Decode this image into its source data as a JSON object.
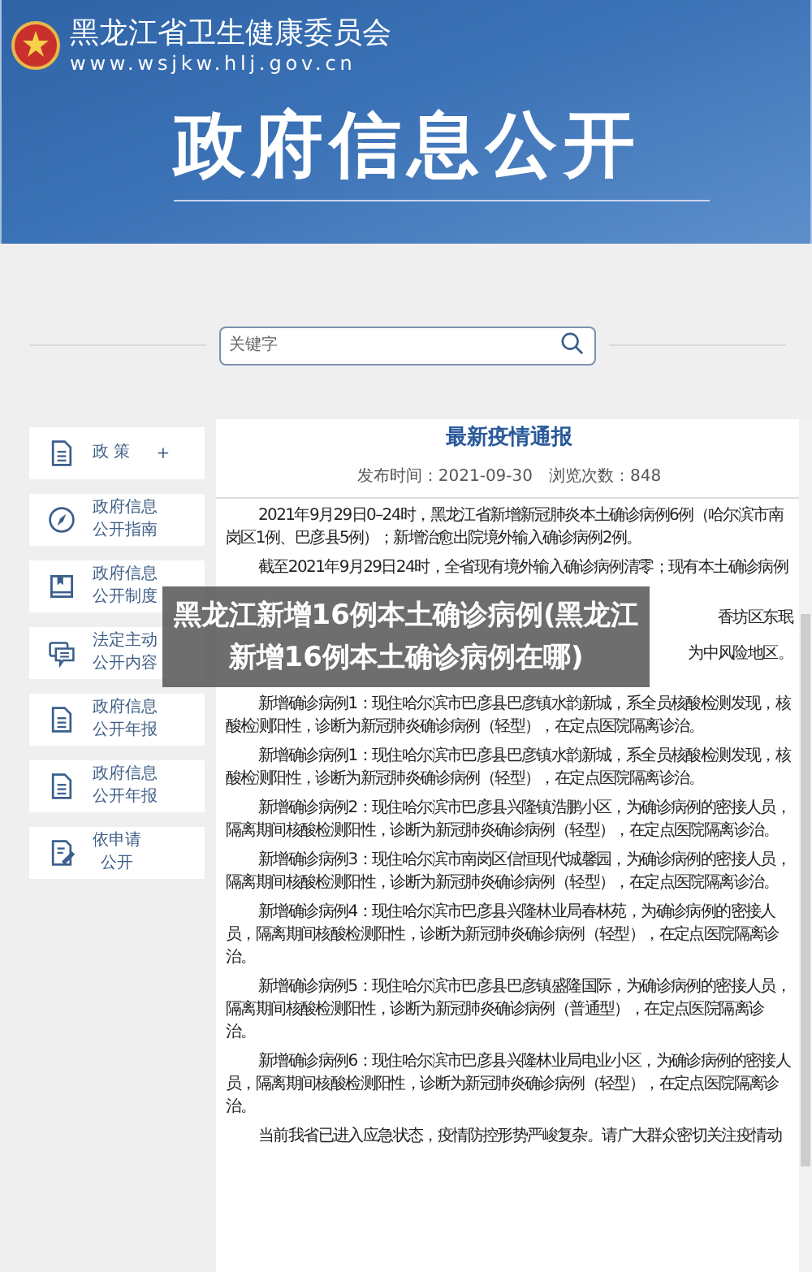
{
  "header": {
    "org_name": "黑龙江省卫生健康委员会",
    "url": "www.wsjkw.hlj.gov.cn",
    "title": "政府信息公开"
  },
  "search": {
    "placeholder": "关键字"
  },
  "sidebar": {
    "items": [
      {
        "lines": [
          "政 策"
        ],
        "expander": "+"
      },
      {
        "lines": [
          "政府信息",
          "公开指南"
        ]
      },
      {
        "lines": [
          "政府信息",
          "公开制度"
        ]
      },
      {
        "lines": [
          "法定主动",
          "公开内容"
        ]
      },
      {
        "lines": [
          "政府信息",
          "公开年报"
        ]
      },
      {
        "lines": [
          "政府信息",
          "公开年报"
        ]
      },
      {
        "lines": [
          "依申请",
          "公开"
        ]
      }
    ]
  },
  "article": {
    "title": "最新疫情通报",
    "meta": "发布时间：2021-09-30　浏览次数：848",
    "paragraphs": [
      {
        "kind": "text",
        "text": "2021年9月29日0–24时，黑龙江省新增新冠肺炎本土确诊病例6例（哈尔滨市南岗区1例、巴彦县5例）；新增治愈出院境外输入确诊病例2例。"
      },
      {
        "kind": "text",
        "text": "截至2021年9月29日24时，全省现有境外输入确诊病例清零；现有本土确诊病例"
      },
      {
        "kind": "covered",
        "fragments": [
          "香坊区东珉",
          "为中风险地区。"
        ]
      },
      {
        "kind": "text",
        "text": "新增确诊病例1：现住哈尔滨市巴彦县巴彦镇水韵新城，系全员核酸检测发现，核酸检测阳性，诊断为新冠肺炎确诊病例（轻型），在定点医院隔离诊治。"
      },
      {
        "kind": "text",
        "text": "新增确诊病例1：现住哈尔滨市巴彦县巴彦镇水韵新城，系全员核酸检测发现，核酸检测阳性，诊断为新冠肺炎确诊病例（轻型），在定点医院隔离诊治。"
      },
      {
        "kind": "text",
        "text": "新增确诊病例2：现住哈尔滨市巴彦县兴隆镇浩鹏小区，为确诊病例的密接人员，隔离期间核酸检测阳性，诊断为新冠肺炎确诊病例（轻型），在定点医院隔离诊治。"
      },
      {
        "kind": "text",
        "text": "新增确诊病例3：现住哈尔滨市南岗区信恒现代城馨园，为确诊病例的密接人员，隔离期间核酸检测阳性，诊断为新冠肺炎确诊病例（轻型），在定点医院隔离诊治。"
      },
      {
        "kind": "text",
        "text": "新增确诊病例4：现住哈尔滨市巴彦县兴隆林业局春林苑，为确诊病例的密接人员，隔离期间核酸检测阳性，诊断为新冠肺炎确诊病例（轻型），在定点医院隔离诊治。"
      },
      {
        "kind": "text",
        "text": "新增确诊病例5：现住哈尔滨市巴彦县巴彦镇盛隆国际，为确诊病例的密接人员，隔离期间核酸检测阳性，诊断为新冠肺炎确诊病例（普通型），在定点医院隔离诊治。"
      },
      {
        "kind": "text",
        "text": "新增确诊病例6：现住哈尔滨市巴彦县兴隆林业局电业小区，为确诊病例的密接人员，隔离期间核酸检测阳性，诊断为新冠肺炎确诊病例（轻型），在定点医院隔离诊治。"
      },
      {
        "kind": "text",
        "text": "当前我省已进入应急状态，疫情防控形势严峻复杂。请广大群众密切关注疫情动"
      }
    ]
  },
  "overlay_caption": "黑龙江新增16例本土确诊病例(黑龙江新增16例本土确诊病例在哪)"
}
